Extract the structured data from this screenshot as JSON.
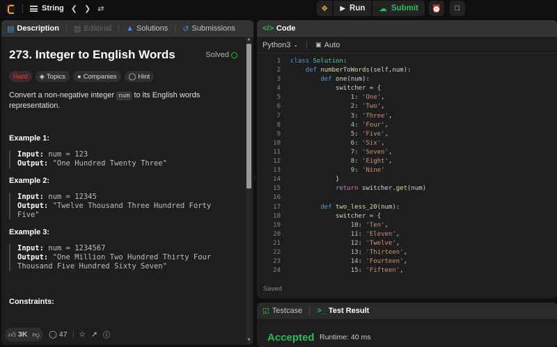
{
  "topbar": {
    "list_label": "String",
    "prev_icon": "chevron-left-icon",
    "next_icon": "chevron-right-icon",
    "shuffle_icon": "shuffle-icon",
    "run_label": "Run",
    "submit_label": "Submit"
  },
  "left_tabs": {
    "description": "Description",
    "editorial": "Editorial",
    "solutions": "Solutions",
    "submissions": "Submissions"
  },
  "problem": {
    "title": "273. Integer to English Words",
    "status": "Solved",
    "difficulty": "Hard",
    "tags": [
      "Topics",
      "Companies",
      "Hint"
    ],
    "desc_before": "Convert a non-negative integer ",
    "desc_code": "num",
    "desc_after": " to its English words representation.",
    "examples": [
      {
        "title": "Example 1:",
        "input_label": "Input:",
        "input": "num = 123",
        "output_label": "Output:",
        "output_line1": "\"One Hundred Twenty Three\"",
        "output_line2": ""
      },
      {
        "title": "Example 2:",
        "input_label": "Input:",
        "input": "num = 12345",
        "output_label": "Output:",
        "output_line1": "\"Twelve Thousand Three Hundred Forty Five\"",
        "output_line2": ""
      },
      {
        "title": "Example 3:",
        "input_label": "Input:",
        "input": "num = 1234567",
        "output_label": "Output:",
        "output_line1": "\"One Million Two Hundred Thirty Four",
        "output_line2": "Thousand Five Hundred Sixty Seven\""
      }
    ],
    "constraints_title": "Constraints:"
  },
  "footer": {
    "likes": "3K",
    "comments": "47"
  },
  "code_panel": {
    "tab_label": "Code",
    "language": "Python3",
    "mode": "Auto",
    "saved": "Saved",
    "lines": [
      {
        "n": "1",
        "html": "<span class='kw'>class</span> <span class='cls'>Solution</span>:"
      },
      {
        "n": "2",
        "html": "    <span class='kw'>def</span> <span class='fn'>numberToWords</span>(self,num):"
      },
      {
        "n": "3",
        "html": "        <span class='kw'>def</span> <span class='fn'>one</span>(num):"
      },
      {
        "n": "4",
        "html": "            switcher = {"
      },
      {
        "n": "5",
        "html": "                <span class='num'>1</span>: <span class='str'>'One'</span>,"
      },
      {
        "n": "6",
        "html": "                <span class='num'>2</span>: <span class='str'>'Two'</span>,"
      },
      {
        "n": "7",
        "html": "                <span class='num'>3</span>: <span class='str'>'Three'</span>,"
      },
      {
        "n": "8",
        "html": "                <span class='num'>4</span>: <span class='str'>'Four'</span>,"
      },
      {
        "n": "9",
        "html": "                <span class='num'>5</span>: <span class='str'>'Five'</span>,"
      },
      {
        "n": "10",
        "html": "                <span class='num'>6</span>: <span class='str'>'Six'</span>,"
      },
      {
        "n": "11",
        "html": "                <span class='num'>7</span>: <span class='str'>'Seven'</span>,"
      },
      {
        "n": "12",
        "html": "                <span class='num'>8</span>: <span class='str'>'Eight'</span>,"
      },
      {
        "n": "13",
        "html": "                <span class='num'>9</span>: <span class='str'>'Nine'</span>"
      },
      {
        "n": "14",
        "html": "            }"
      },
      {
        "n": "15",
        "html": "            <span class='kw2'>return</span> switcher.<span class='fn'>get</span>(num)"
      },
      {
        "n": "16",
        "html": ""
      },
      {
        "n": "17",
        "html": "        <span class='kw'>def</span> <span class='fn'>two_less_20</span>(num):"
      },
      {
        "n": "18",
        "html": "            switcher = {"
      },
      {
        "n": "19",
        "html": "                <span class='num'>10</span>: <span class='str'>'Ten'</span>,"
      },
      {
        "n": "20",
        "html": "                <span class='num'>11</span>: <span class='str'>'Eleven'</span>,"
      },
      {
        "n": "21",
        "html": "                <span class='num'>12</span>: <span class='str'>'Twelve'</span>,"
      },
      {
        "n": "22",
        "html": "                <span class='num'>13</span>: <span class='str'>'Thirteen'</span>,"
      },
      {
        "n": "23",
        "html": "                <span class='num'>14</span>: <span class='str'>'Fourteen'</span>,"
      },
      {
        "n": "24",
        "html": "                <span class='num'>15</span>: <span class='str'>'Fifteen'</span>,"
      }
    ]
  },
  "result_panel": {
    "testcase_tab": "Testcase",
    "result_tab": "Test Result",
    "verdict": "Accepted",
    "runtime": "Runtime: 40 ms"
  },
  "colors": {
    "accent_green": "#2cbb5d",
    "hard_red": "#f63737",
    "brand_orange": "#ffa116"
  }
}
